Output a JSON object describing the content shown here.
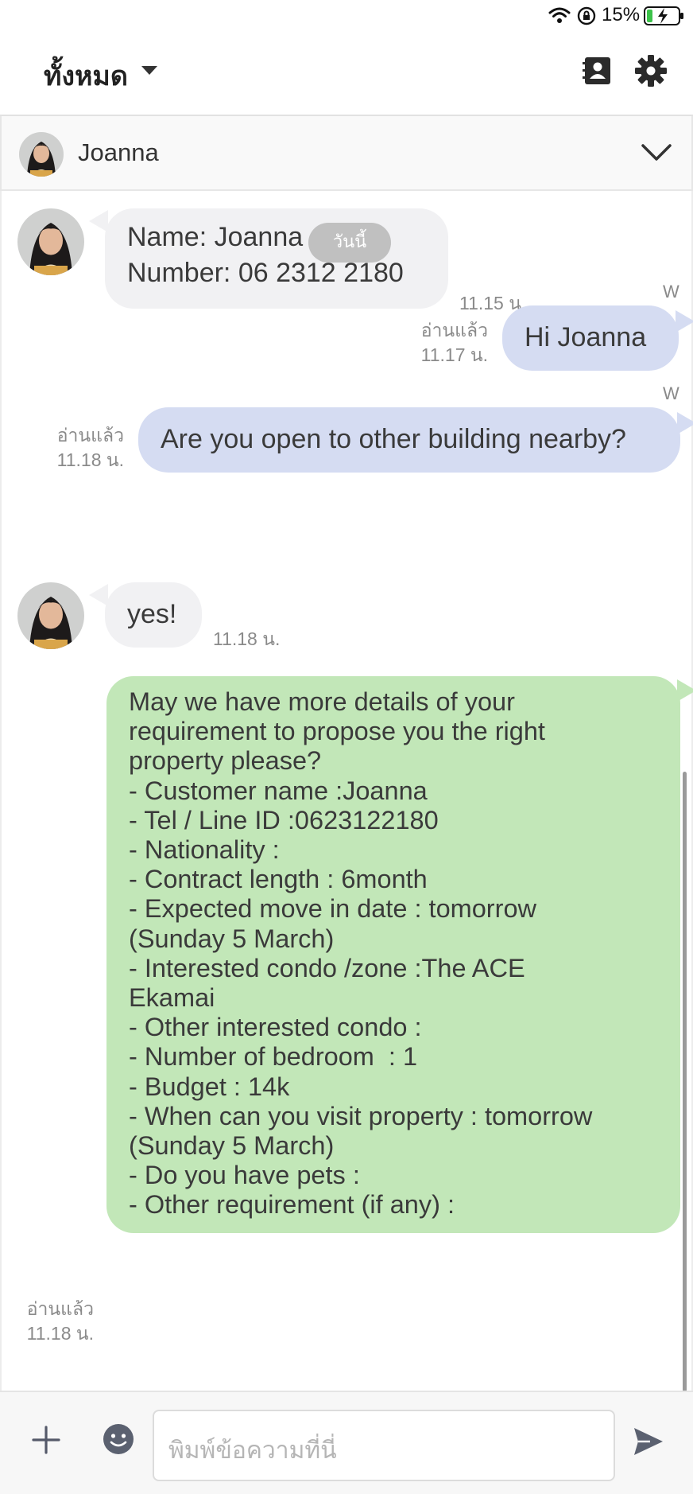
{
  "status_bar": {
    "battery_pct": "15%"
  },
  "header": {
    "filter_label": "ทั้งหมด"
  },
  "conversation": {
    "contact_name": "Joanna"
  },
  "date_chip": "วันนี้",
  "messages": {
    "m1": {
      "lines": [
        "Name: Joanna",
        "Number: 06 2312 2180"
      ],
      "time": "11.15 น."
    },
    "m2": {
      "sender": "W",
      "text": "Hi Joanna",
      "read": "อ่านแล้ว",
      "time": "11.17 น."
    },
    "m3": {
      "sender": "W",
      "text": "Are you open to other building nearby?",
      "read": "อ่านแล้ว",
      "time": "11.18 น."
    },
    "m4": {
      "text": "yes!",
      "time": "11.18 น."
    },
    "m5": {
      "text": "May we have more details of your\nrequirement to propose you the right\nproperty please?\n- Customer name :Joanna\n- Tel / Line ID :0623122180\n- Nationality :\n- Contract length : 6month\n- Expected move in date : tomorrow\n(Sunday 5 March)\n- Interested condo /zone :The ACE\nEkamai\n- Other interested condo :\n- Number of bedroom  : 1\n- Budget : 14k\n- When can you visit property : tomorrow\n(Sunday 5 March)\n- Do you have pets :\n- Other requirement (if any) :",
      "read": "อ่านแล้ว",
      "time": "11.18 น."
    }
  },
  "input": {
    "placeholder": "พิมพ์ข้อความที่นี่"
  },
  "colors": {
    "incoming_bubble": "#f1f1f3",
    "outgoing_bubble": "#d5dcf2",
    "template_bubble": "#c2e7b8"
  }
}
